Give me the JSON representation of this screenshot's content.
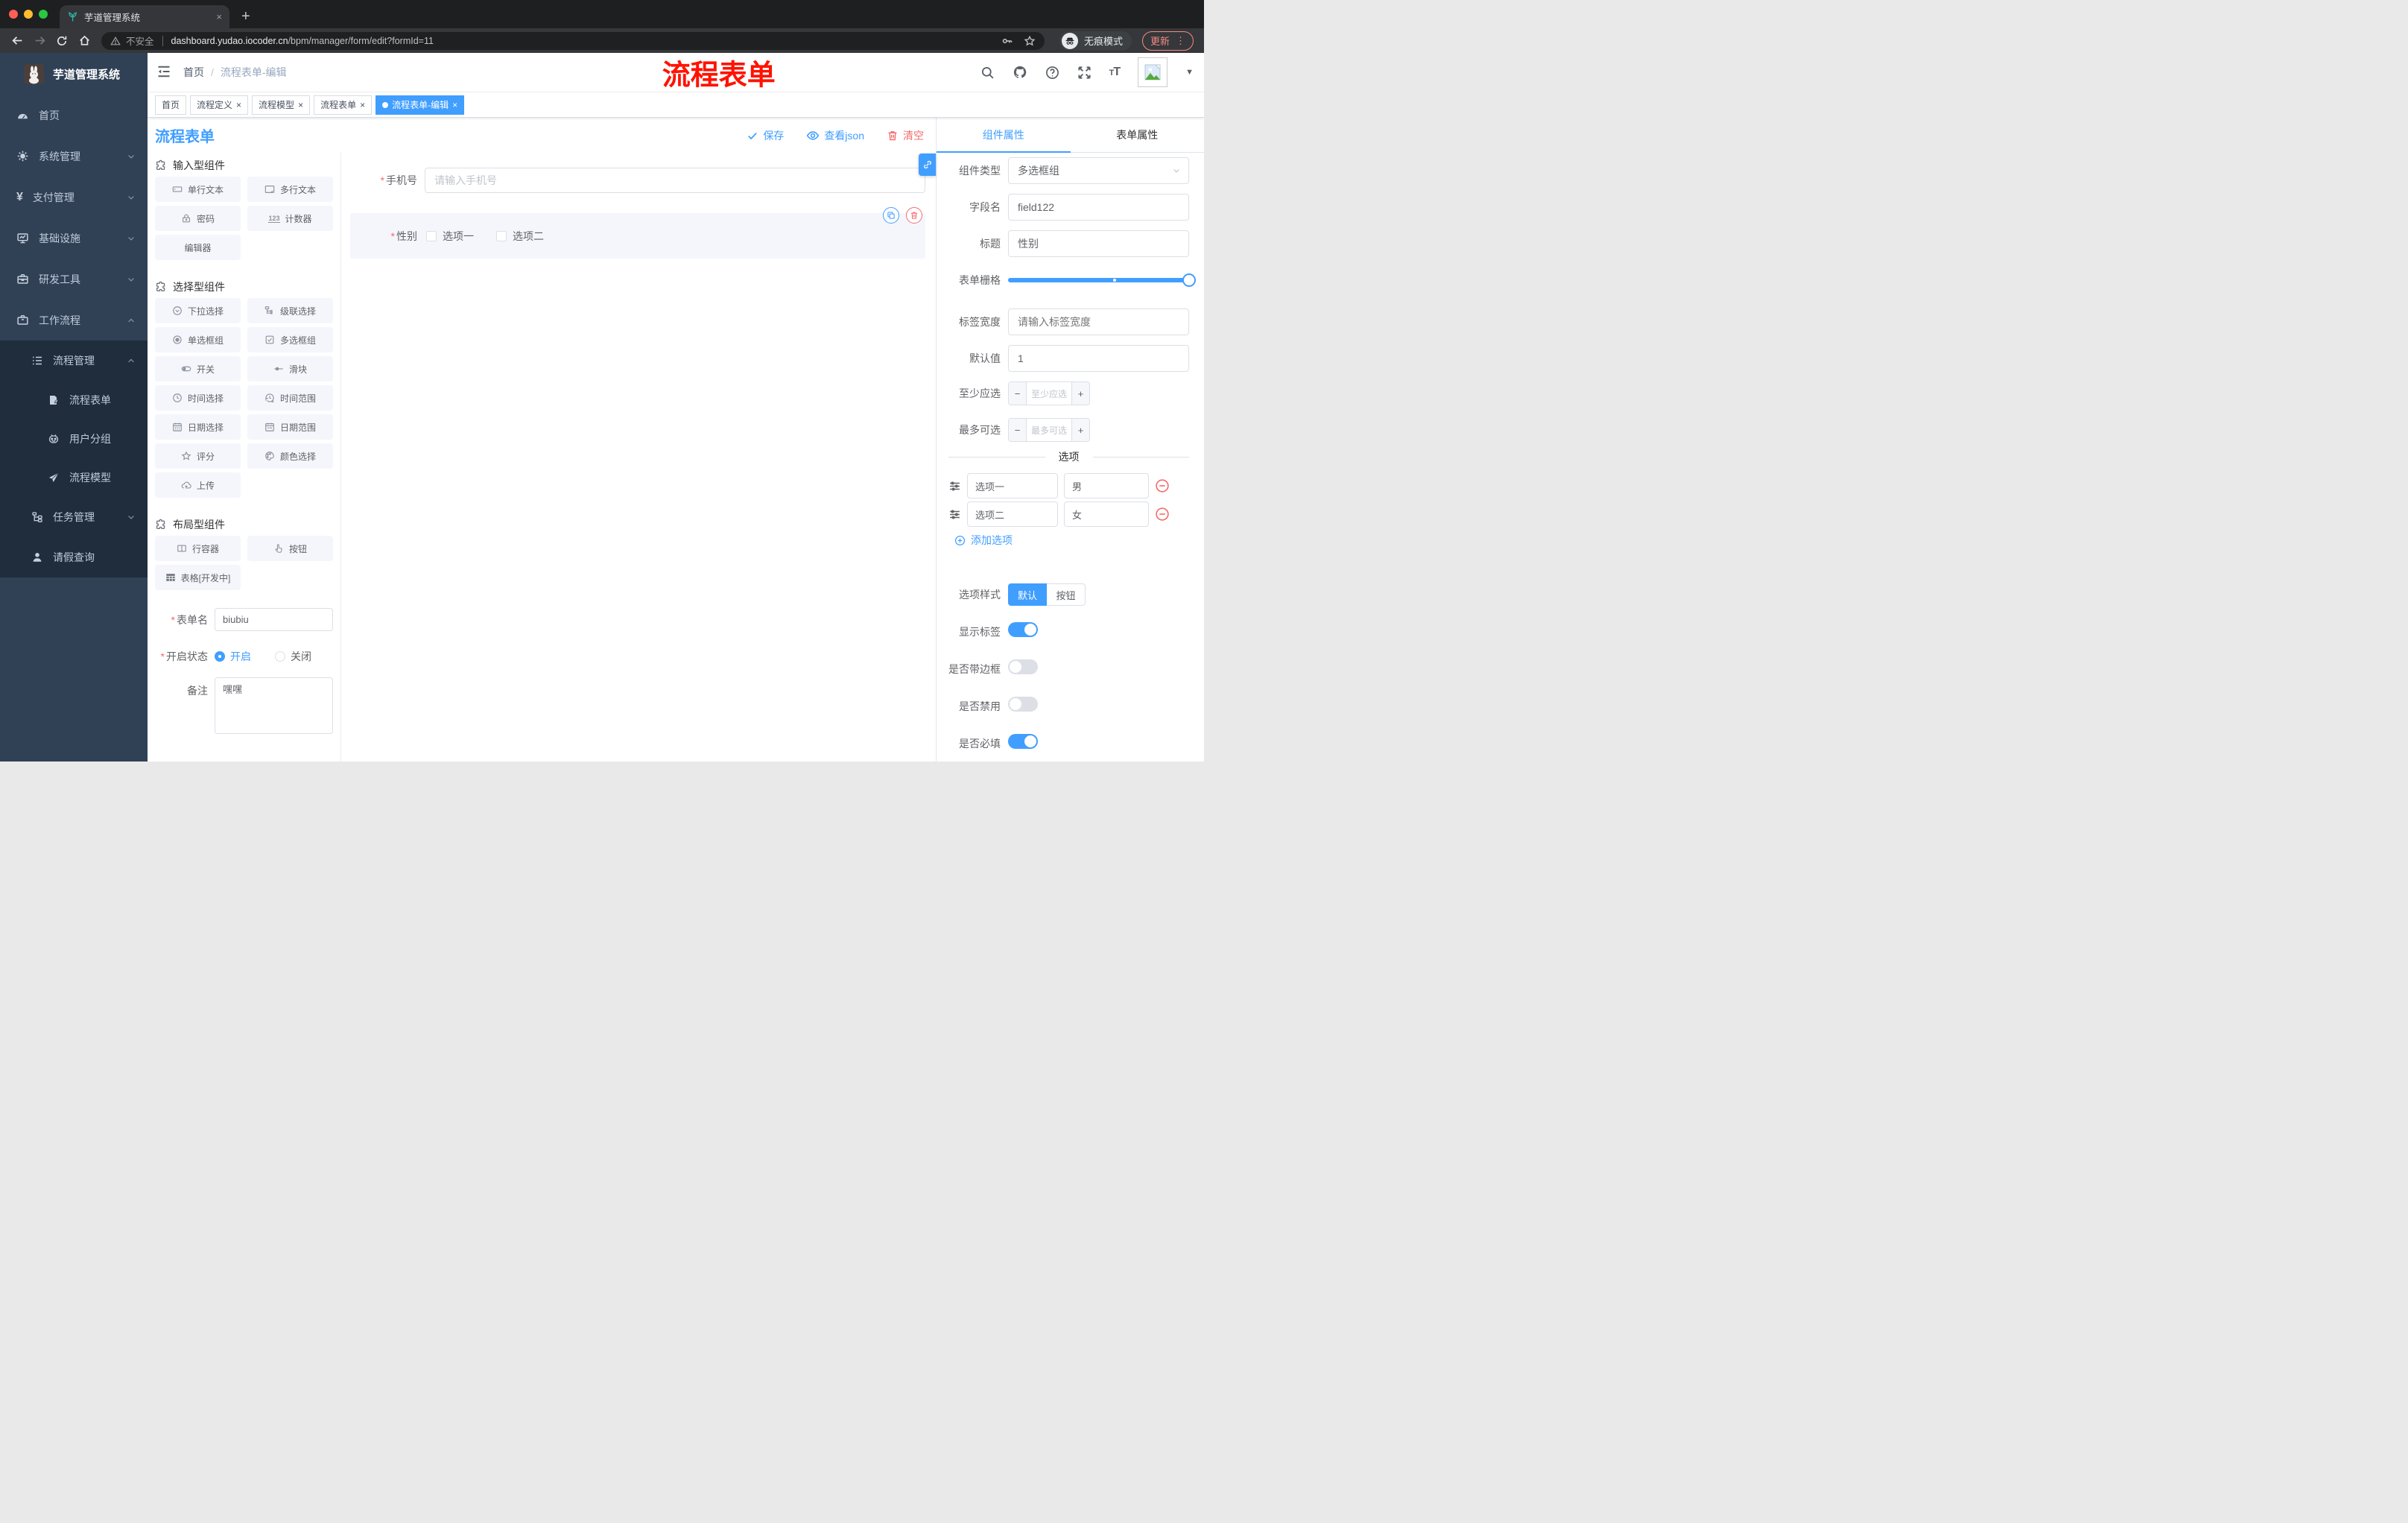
{
  "palette": {
    "accent": "#409eff",
    "danger": "#f56c6c",
    "annotation_red": "#ff1200",
    "sidebar_bg": "#304156",
    "sidebar_submenu_bg": "#1f2d3d"
  },
  "browser": {
    "tab": {
      "title": "芋道管理系统",
      "close": "×",
      "new_tab": "+"
    },
    "address": {
      "security": "不安全",
      "domain": "dashboard.yudao.iocoder.cn",
      "path": "/bpm/manager/form/edit?formId=11"
    },
    "incognito_label": "无痕模式",
    "update_button": "更新",
    "menu_dots": "⋮"
  },
  "sidebar": {
    "app_title": "芋道管理系统",
    "items": [
      {
        "label": "首页"
      },
      {
        "label": "系统管理"
      },
      {
        "label": "支付管理"
      },
      {
        "label": "基础设施"
      },
      {
        "label": "研发工具"
      },
      {
        "label": "工作流程"
      }
    ],
    "submenu": {
      "group": "流程管理",
      "children": [
        {
          "label": "流程表单"
        },
        {
          "label": "用户分组"
        },
        {
          "label": "流程模型"
        }
      ],
      "siblings": [
        {
          "label": "任务管理"
        },
        {
          "label": "请假查询"
        }
      ]
    }
  },
  "header": {
    "breadcrumb": {
      "home": "首页",
      "separator": "/",
      "current": "流程表单-编辑"
    },
    "annotation": "流程表单"
  },
  "tags": [
    {
      "label": "首页"
    },
    {
      "label": "流程定义"
    },
    {
      "label": "流程模型"
    },
    {
      "label": "流程表单"
    },
    {
      "label": "流程表单-编辑"
    }
  ],
  "designer": {
    "title": "流程表单",
    "actions": {
      "save": "保存",
      "view_json": "查看json",
      "clear": "清空"
    }
  },
  "components_panel": {
    "sections": [
      {
        "title": "输入型组件",
        "items": [
          "单行文本",
          "多行文本",
          "密码",
          "计数器",
          "编辑器"
        ]
      },
      {
        "title": "选择型组件",
        "items": [
          "下拉选择",
          "级联选择",
          "单选框组",
          "多选框组",
          "开关",
          "滑块",
          "时间选择",
          "时间范围",
          "日期选择",
          "日期范围",
          "评分",
          "颜色选择",
          "上传"
        ]
      },
      {
        "title": "布局型组件",
        "items": [
          "行容器",
          "按钮",
          "表格[开发中]"
        ]
      }
    ],
    "form_meta": {
      "name_label": "表单名",
      "name_value": "biubiu",
      "status_label": "开启状态",
      "status_on": "开启",
      "status_off": "关闭",
      "remark_label": "备注",
      "remark_value": "嘿嘿"
    }
  },
  "canvas": {
    "phone": {
      "label": "手机号",
      "placeholder": "请输入手机号"
    },
    "gender": {
      "label": "性别",
      "option1": "选项一",
      "option2": "选项二"
    }
  },
  "properties": {
    "tabs": {
      "component": "组件属性",
      "form": "表单属性"
    },
    "component_type": {
      "label": "组件类型",
      "value": "多选框组"
    },
    "field_name": {
      "label": "字段名",
      "value": "field122"
    },
    "title": {
      "label": "标题",
      "value": "性别"
    },
    "form_grid": {
      "label": "表单栅格"
    },
    "label_width": {
      "label": "标签宽度",
      "placeholder": "请输入标签宽度"
    },
    "default_value": {
      "label": "默认值",
      "value": "1"
    },
    "min_select": {
      "label": "至少应选",
      "placeholder": "至少应选"
    },
    "max_select": {
      "label": "最多可选",
      "placeholder": "最多可选"
    },
    "options": {
      "divider": "选项",
      "rows": [
        {
          "name": "选项一",
          "value": "男"
        },
        {
          "name": "选项二",
          "value": "女"
        }
      ],
      "add": "添加选项"
    },
    "option_style": {
      "label": "选项样式",
      "default_btn": "默认",
      "button_btn": "按钮"
    },
    "switches": [
      {
        "label": "显示标签"
      },
      {
        "label": "是否带边框"
      },
      {
        "label": "是否禁用"
      },
      {
        "label": "是否必填"
      }
    ]
  }
}
